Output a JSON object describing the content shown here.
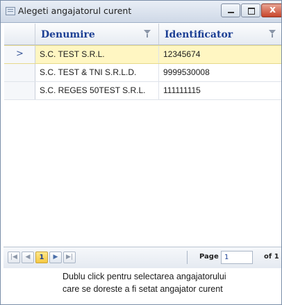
{
  "window": {
    "title": "Alegeti angajatorul curent",
    "close_glyph": "x"
  },
  "grid": {
    "columns": [
      {
        "label": "Denumire"
      },
      {
        "label": "Identificator"
      }
    ],
    "rows": [
      {
        "denumire": "S.C. TEST S.R.L.",
        "identificator": "12345674",
        "selected": true
      },
      {
        "denumire": "S.C. TEST & TNI S.R.L.D.",
        "identificator": "9999530008",
        "selected": false
      },
      {
        "denumire": "S.C. REGES 50TEST S.R.L.",
        "identificator": "111111115",
        "selected": false
      }
    ],
    "current_row_indicator": ">"
  },
  "pager": {
    "current_page_button": "1",
    "page_label": "Page",
    "page_input": "1",
    "of_label": "of 1"
  },
  "footer": {
    "line1": "Dublu click pentru selectarea angajatorului",
    "line2": "care se doreste a fi setat angajator curent"
  },
  "colors": {
    "header_text": "#1c3f94",
    "selected_row": "#fff6c2",
    "close_button": "#c8452b"
  }
}
